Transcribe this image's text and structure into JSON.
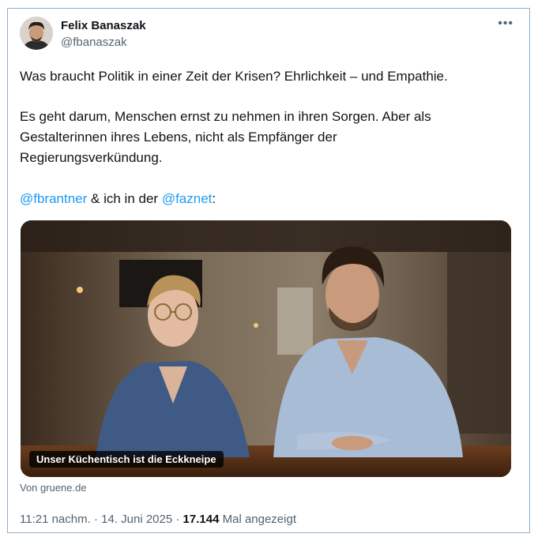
{
  "author": {
    "name": "Felix Banaszak",
    "handle": "@fbanaszak"
  },
  "icons": {
    "more": "more-horizontal-icon",
    "avatar": "profile-photo"
  },
  "tweet": {
    "paragraph1": "Was braucht Politik in einer Zeit der Krisen? Ehrlichkeit – und Empathie.",
    "paragraph2_line1": "Es geht darum, Menschen ernst zu nehmen in ihren Sorgen. Aber als",
    "paragraph2_line2": "Gestalterinnen ihres Lebens, nicht als Empfänger der",
    "paragraph2_line3": "Regierungsverkündung.",
    "mention1": "@fbrantner",
    "connector": " & ich in der ",
    "mention2": "@faznet",
    "suffix": ":"
  },
  "link_card": {
    "caption": "Unser Küchentisch ist die Eckkneipe",
    "source": "Von gruene.de"
  },
  "footer": {
    "time": "11:21 nachm.",
    "separator": " · ",
    "date": "14. Juni 2025",
    "views": "17.144",
    "views_label": " Mal angezeigt"
  },
  "colors": {
    "link": "#1d9bf0",
    "text": "#0f1419",
    "muted": "#536471",
    "border": "#8fb1c9"
  }
}
